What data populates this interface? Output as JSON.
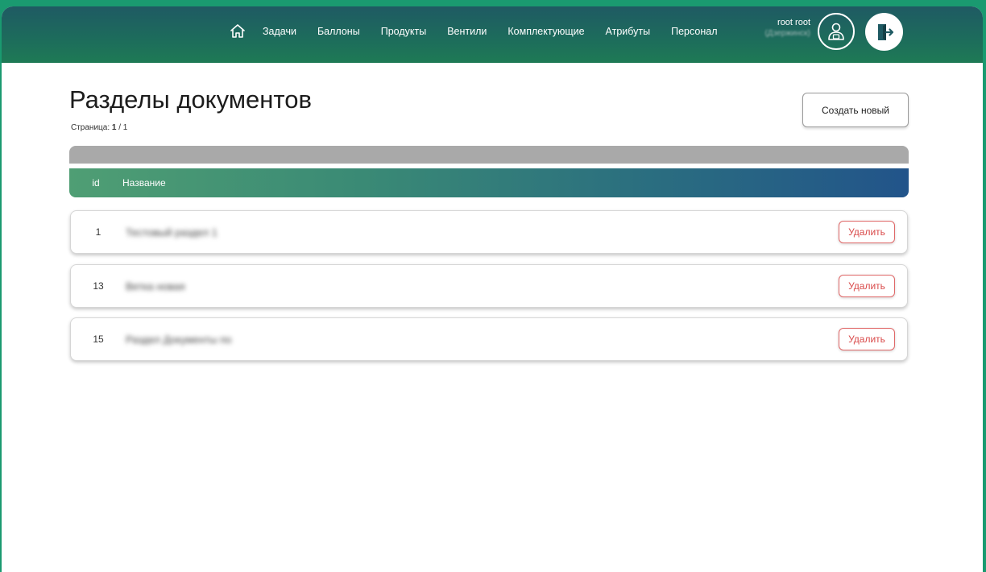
{
  "nav": {
    "home_icon": "home-icon",
    "items": [
      "Задачи",
      "Баллоны",
      "Продукты",
      "Вентили",
      "Комплектующие",
      "Атрибуты",
      "Персонал"
    ]
  },
  "user": {
    "name": "root root",
    "city": "(Дзержинск)",
    "profile_icon": "user-profile-icon",
    "logout_icon": "logout-icon"
  },
  "page": {
    "title": "Разделы документов",
    "pagination_label": "Страница:",
    "pagination_value": "1",
    "pagination_total": "/ 1",
    "create_button": "Создать новый"
  },
  "table": {
    "headers": {
      "id": "id",
      "name": "Название"
    },
    "rows": [
      {
        "id": "1",
        "name": "Тестовый раздел 1",
        "delete_label": "Удалить"
      },
      {
        "id": "13",
        "name": "Ветка новая",
        "delete_label": "Удалить"
      },
      {
        "id": "15",
        "name": "Раздел Документы по",
        "delete_label": "Удалить"
      }
    ]
  },
  "colors": {
    "header_gradient_start": "#4f9e74",
    "header_gradient_end": "#22548a",
    "delete_accent": "#d94a4a",
    "topbar": "#1d6b5c"
  }
}
